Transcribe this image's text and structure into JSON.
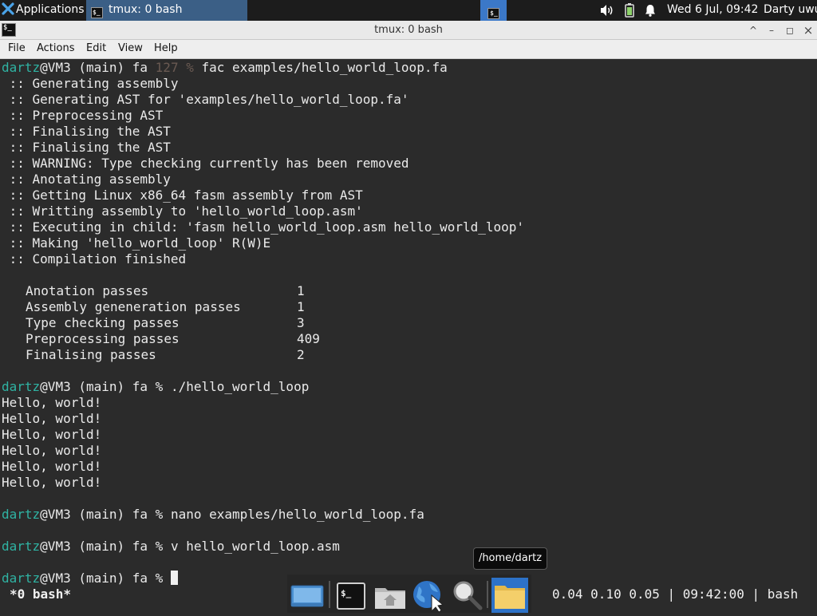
{
  "panel": {
    "applications_label": "Applications",
    "task_title": "tmux: 0 bash",
    "clock": "Wed  6 Jul, 09:42",
    "user": "Darty uwu",
    "icons": [
      "xfce-logo-icon",
      "terminal-icon",
      "volume-icon",
      "battery-icon",
      "notification-bell-icon"
    ]
  },
  "window": {
    "title": "tmux: 0 bash",
    "controls": [
      "^",
      "–",
      "◻",
      "×"
    ]
  },
  "menu": [
    "File",
    "Actions",
    "Edit",
    "View",
    "Help"
  ],
  "terminal": {
    "prompt_user": "dartz",
    "prompt_host": "@VM3 (main) fa ",
    "prompt_sep": "% ",
    "status_code": "127 ",
    "commands": [
      "fac examples/hello_world_loop.fa",
      "./hello_world_loop",
      "nano examples/hello_world_loop.fa",
      "v hello_world_loop.asm"
    ],
    "compile_log": [
      " :: Generating assembly",
      " :: Generating AST for 'examples/hello_world_loop.fa'",
      " :: Preprocessing AST",
      " :: Finalising the AST",
      " :: Finalising the AST",
      " :: WARNING: Type checking currently has been removed",
      " :: Anotating assembly",
      " :: Getting Linux x86_64 fasm assembly from AST",
      " :: Writting assembly to 'hello_world_loop.asm'",
      " :: Executing in child: 'fasm hello_world_loop.asm hello_world_loop'",
      " :: Making 'hello_world_loop' R(W)E",
      " :: Compilation finished"
    ],
    "stats": [
      {
        "name": "Anotation passes",
        "value": "1"
      },
      {
        "name": "Assembly geneneration passes",
        "value": "1"
      },
      {
        "name": "Type checking passes",
        "value": "3"
      },
      {
        "name": "Preprocessing passes",
        "value": "409"
      },
      {
        "name": "Finalising passes",
        "value": "2"
      }
    ],
    "program_output": [
      "Hello, world!",
      "Hello, world!",
      "Hello, world!",
      "Hello, world!",
      "Hello, world!",
      "Hello, world!"
    ]
  },
  "tmux": {
    "window_label": "*0 bash*",
    "load_avg": "0.04 0.10 0.05",
    "time": "09:42:00",
    "session": "bash",
    "separator": "|"
  },
  "dock": {
    "items": [
      "desktop-icon",
      "terminal-icon",
      "home-folder-icon",
      "web-browser-icon",
      "search-icon",
      "file-manager-icon"
    ],
    "tooltip": "/home/dartz"
  },
  "colors": {
    "prompt_user": "#2fb3a3",
    "status_code": "#6a5a52",
    "terminal_bg": "#2b2b2b",
    "taskbar_active": "#3b5f86"
  }
}
